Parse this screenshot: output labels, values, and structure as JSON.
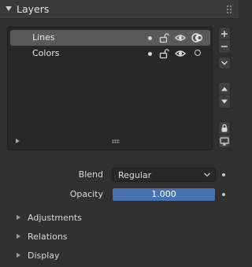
{
  "panel": {
    "title": "Layers"
  },
  "layers": [
    {
      "name": "Lines",
      "selected": true
    },
    {
      "name": "Colors",
      "selected": false
    }
  ],
  "side_buttons": [
    "add-icon",
    "remove-icon",
    "dropdown-icon",
    "move-up-icon",
    "move-down-icon",
    "lock-icon",
    "screen-icon"
  ],
  "blend": {
    "label": "Blend",
    "value": "Regular"
  },
  "opacity": {
    "label": "Opacity",
    "value": "1.000"
  },
  "subpanels": [
    "Adjustments",
    "Relations",
    "Display"
  ],
  "colors": {
    "accent": "#4772b3",
    "background": "#303030",
    "list_bg": "#282828"
  }
}
